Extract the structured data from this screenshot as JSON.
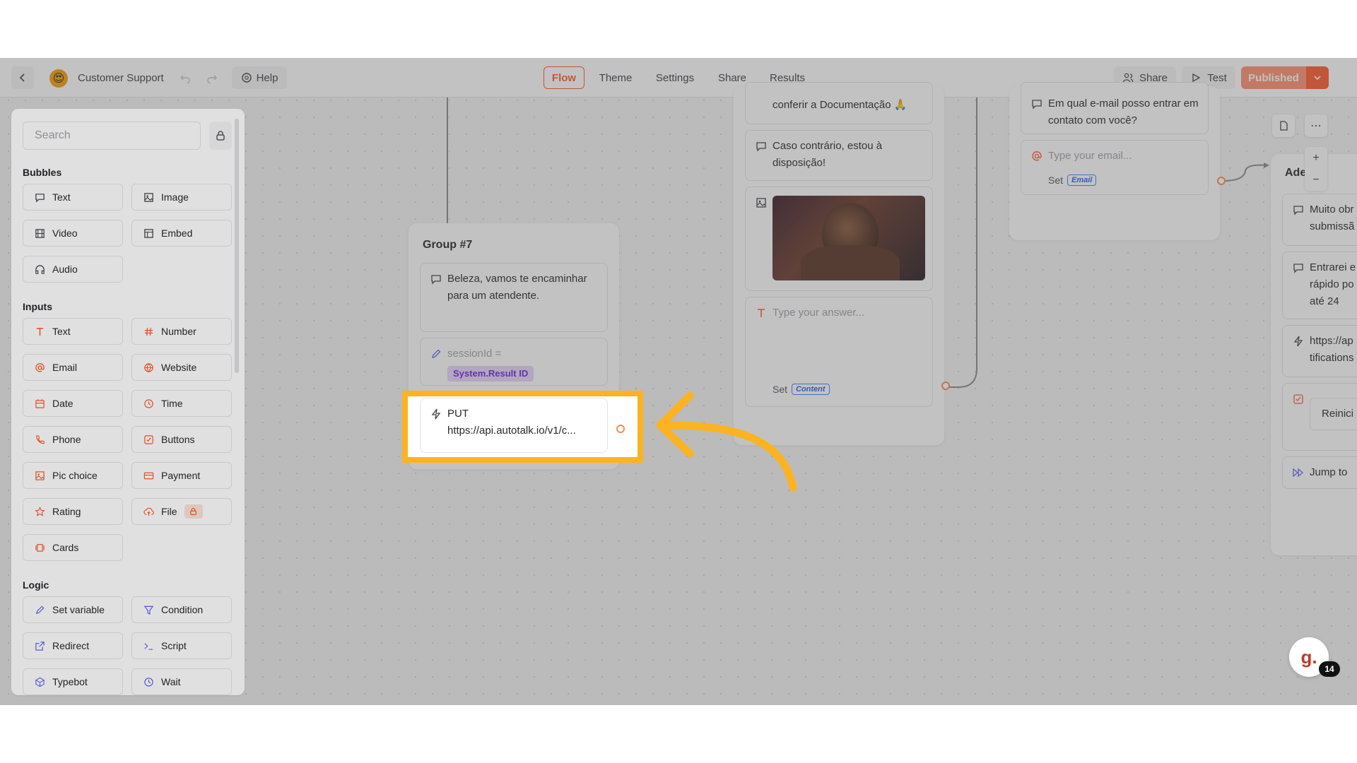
{
  "topbar": {
    "project_name": "Customer Support",
    "help_label": "Help",
    "tabs": [
      {
        "label": "Flow",
        "active": true
      },
      {
        "label": "Theme"
      },
      {
        "label": "Settings"
      },
      {
        "label": "Share"
      },
      {
        "label": "Results"
      }
    ],
    "share_label": "Share",
    "test_label": "Test",
    "publish_label": "Published"
  },
  "sidebar": {
    "search_placeholder": "Search",
    "sections": {
      "bubbles": "Bubbles",
      "inputs": "Inputs",
      "logic": "Logic"
    },
    "bubbles": [
      "Text",
      "Image",
      "Video",
      "Embed",
      "Audio"
    ],
    "inputs": [
      "Text",
      "Number",
      "Email",
      "Website",
      "Date",
      "Time",
      "Phone",
      "Buttons",
      "Pic choice",
      "Payment",
      "Rating",
      "File",
      "Cards"
    ],
    "logic": [
      "Set variable",
      "Condition",
      "Redirect",
      "Script",
      "Typebot",
      "Wait"
    ]
  },
  "canvas": {
    "group7": {
      "title": "Group #7",
      "text_bubble": "Beleza, vamos te encaminhar para um atendente.",
      "set_var_label": "sessionId =",
      "set_var_value": "System.Result ID",
      "webhook_method": "PUT",
      "webhook_url": "https://api.autotalk.io/v1/c..."
    },
    "middle_group": {
      "doc_text": "conferir a Documentação 🙏",
      "text2": "Caso contrário, estou à disposição!",
      "answer_placeholder": "Type your answer...",
      "set_label": "Set",
      "set_var": "Content"
    },
    "right_group": {
      "question": "Em qual e-mail posso entrar em contato com você?",
      "email_placeholder": "Type your email...",
      "set_label": "Set",
      "set_var": "Email"
    },
    "far_right_group": {
      "title": "Ade",
      "text1": "Muito obr submissã",
      "text2": "Entrarei e rápido po em até 24",
      "webhook": "https://ap tifications",
      "button": "Reinici",
      "jump": "Jump to"
    }
  },
  "badge_count": "14",
  "fab_letter": "g.",
  "colors": {
    "accent": "#ff5a2b",
    "highlight": "#fbb321",
    "tag_purple": "#e9d5ff"
  }
}
